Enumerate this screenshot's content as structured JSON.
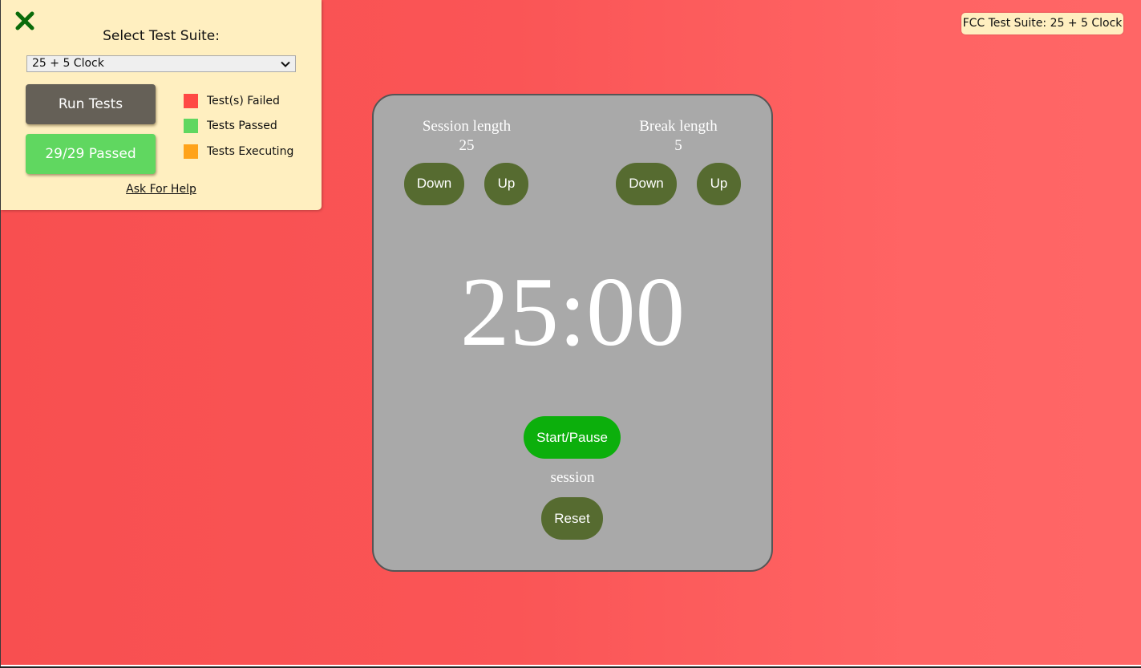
{
  "fcc_panel": {
    "close_icon": "close-x-icon",
    "title": "Select Test Suite:",
    "suite_select": {
      "selected": "25 + 5 Clock"
    },
    "run_tests_label": "Run Tests",
    "results_label": "29/29 Passed",
    "legend": [
      {
        "label": "Test(s) Failed",
        "color": "#ff4944"
      },
      {
        "label": "Tests Passed",
        "color": "#60d760"
      },
      {
        "label": "Tests Executing",
        "color": "#ffa31a"
      }
    ],
    "help_link": "Ask For Help"
  },
  "fcc_badge": "FCC Test Suite: 25 + 5 Clock",
  "clock": {
    "session": {
      "label": "Session length",
      "value": "25",
      "down_label": "Down",
      "up_label": "Up"
    },
    "break": {
      "label": "Break length",
      "value": "5",
      "down_label": "Down",
      "up_label": "Up"
    },
    "time_left": "25:00",
    "start_pause_label": "Start/Pause",
    "timer_label": "session",
    "reset_label": "Reset"
  },
  "colors": {
    "accent_green": "#566b30",
    "start_green": "#0caf0c",
    "card_gray": "#a9a9a9",
    "panel_bg": "#ffefc0"
  }
}
